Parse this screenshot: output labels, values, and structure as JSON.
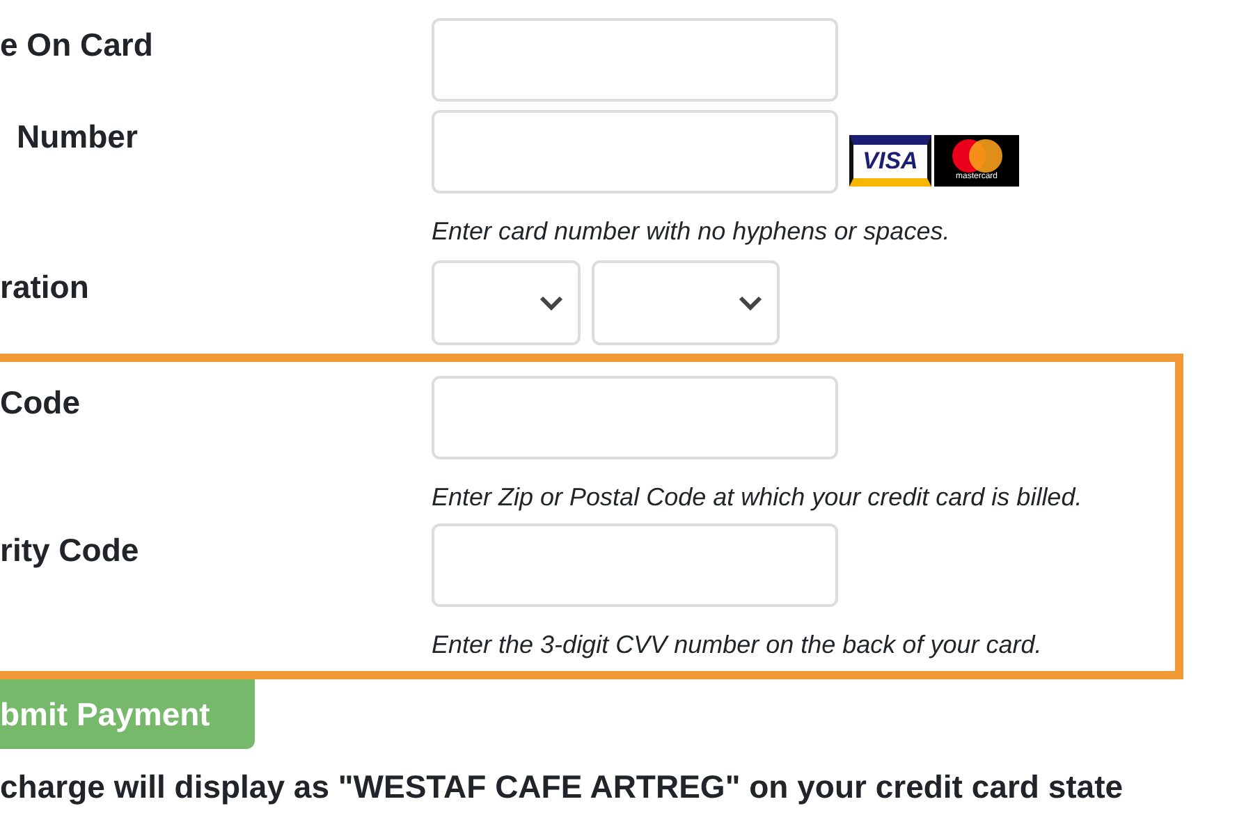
{
  "fields": [
    {
      "label": "e On Card",
      "kind": "text"
    },
    {
      "label": "Number",
      "kind": "card",
      "hint": "Enter card number with no hyphens or spaces."
    },
    {
      "label": "ration",
      "kind": "expiry"
    }
  ],
  "card_logos": [
    {
      "label": "VISA",
      "kind": "visa"
    },
    {
      "label": "mastercard",
      "kind": "mastercard"
    }
  ],
  "highlighted_fields": [
    {
      "label": "Code",
      "kind": "text",
      "hint": "Enter Zip or Postal Code at which your credit card is billed."
    },
    {
      "label": "rity Code",
      "kind": "text",
      "hint": "Enter the 3-digit CVV number on the back of your card."
    }
  ],
  "submit_button": "bmit Payment",
  "note": "charge will display as \"WESTAF CAFE ARTREG\" on your credit card state"
}
